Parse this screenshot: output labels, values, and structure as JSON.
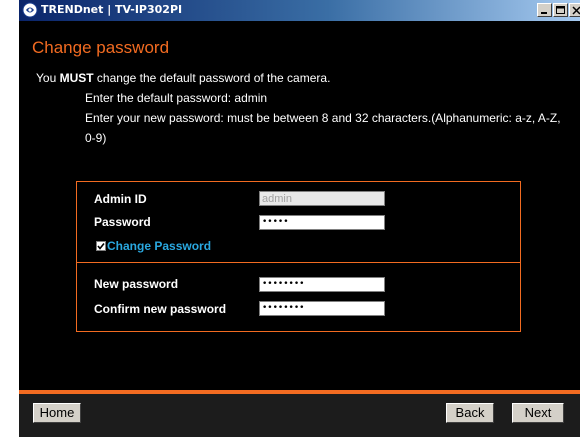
{
  "window": {
    "title": "TRENDnet | TV-IP302PI"
  },
  "page": {
    "title": "Change password",
    "intro_prefix": "You ",
    "intro_bold": "MUST",
    "intro_suffix": " change the default password of the camera.",
    "hint_default": "Enter the default password: admin",
    "hint_new_line1": "Enter your new password: must be between 8 and 32 characters.(Alphanumeric: a-z, A-Z,",
    "hint_new_line2": "0-9)"
  },
  "form": {
    "admin_id_label": "Admin ID",
    "admin_id_value": "admin",
    "password_label": "Password",
    "password_value": "•••••",
    "change_password_label": "Change Password",
    "change_password_checked": true,
    "new_password_label": "New password",
    "new_password_value": "••••••••",
    "confirm_password_label": "Confirm new password",
    "confirm_password_value": "••••••••"
  },
  "footer": {
    "home_label": "Home",
    "back_label": "Back",
    "next_label": "Next"
  },
  "colors": {
    "accent": "#f26b21",
    "link": "#2aa8e0",
    "background": "#000000"
  }
}
